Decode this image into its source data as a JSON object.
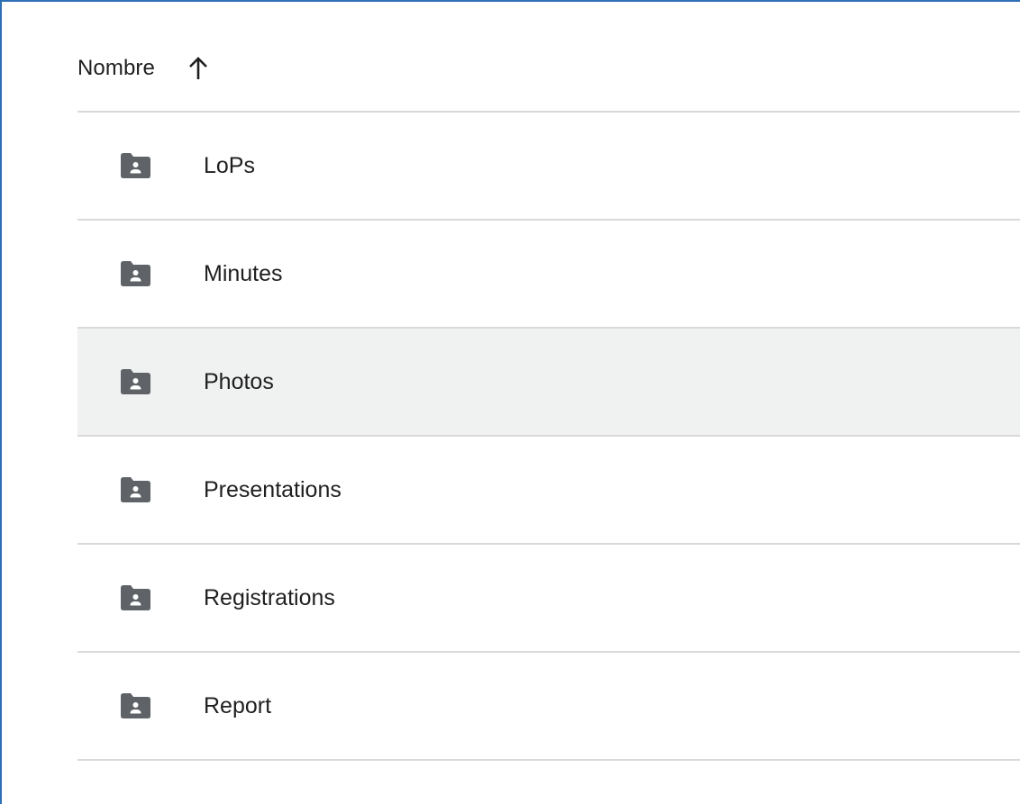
{
  "header": {
    "label": "Nombre",
    "sort_icon": "arrow-up-icon"
  },
  "colors": {
    "frame_border": "#2f6fb5",
    "divider": "#d9d9d9",
    "hover_row": "#f0f1f1",
    "icon": "#5f6368",
    "text": "#1f1f1f"
  },
  "folders": [
    {
      "name": "LoPs",
      "icon": "shared-folder-icon",
      "hovered": false
    },
    {
      "name": "Minutes",
      "icon": "shared-folder-icon",
      "hovered": false
    },
    {
      "name": "Photos",
      "icon": "shared-folder-icon",
      "hovered": true
    },
    {
      "name": "Presentations",
      "icon": "shared-folder-icon",
      "hovered": false
    },
    {
      "name": "Registrations",
      "icon": "shared-folder-icon",
      "hovered": false
    },
    {
      "name": "Report",
      "icon": "shared-folder-icon",
      "hovered": false
    }
  ]
}
